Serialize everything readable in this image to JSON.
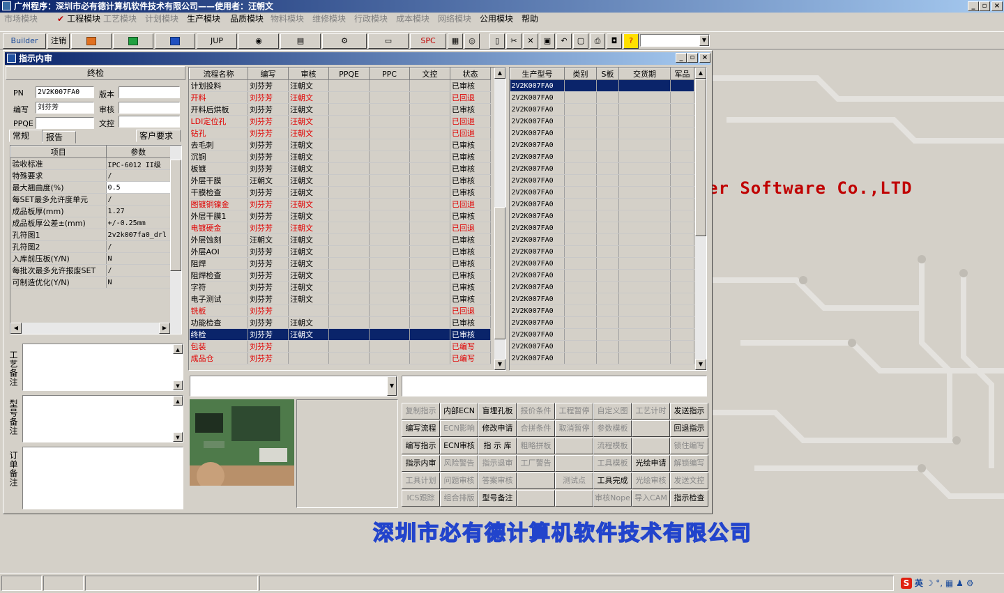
{
  "window_title": "广州程序：深圳市必有德计算机软件技术有限公司——使用者：汪朝文",
  "menu": [
    {
      "label": "市场模块",
      "enabled": false
    },
    {
      "label": "工程模块",
      "enabled": true,
      "checked": true
    },
    {
      "label": "工艺模块",
      "enabled": false
    },
    {
      "label": "计划模块",
      "enabled": false
    },
    {
      "label": "生产模块",
      "enabled": true
    },
    {
      "label": "品质模块",
      "enabled": true
    },
    {
      "label": "物料模块",
      "enabled": false
    },
    {
      "label": "维修模块",
      "enabled": false
    },
    {
      "label": "行政模块",
      "enabled": false
    },
    {
      "label": "成本模块",
      "enabled": false
    },
    {
      "label": "网络模块",
      "enabled": false
    },
    {
      "label": "公用模块",
      "enabled": true
    },
    {
      "label": "帮助",
      "enabled": true
    }
  ],
  "toolbar": {
    "builder": "Builder",
    "logout": "注销",
    "jup": "JUP",
    "spc": "SPC"
  },
  "child_title": "指示内审",
  "left": {
    "header": "终检",
    "pn_label": "PN",
    "pn_value": "2V2K007FA0",
    "version_label": "版本",
    "version_value": "",
    "author_label": "编写",
    "author_value": "刘芬芳",
    "review_label": "审核",
    "review_value": "",
    "ppqe_label": "PPQE",
    "ppqe_value": "",
    "doc_label": "文控",
    "doc_value": "",
    "tabs": [
      "常规",
      "报告",
      "客户要求"
    ],
    "param_headers": [
      "项目",
      "参数"
    ],
    "params": [
      [
        "验收标准",
        "IPC-6012 II级"
      ],
      [
        "特殊要求",
        "/"
      ],
      [
        "最大翘曲度(%)",
        "0.5"
      ],
      [
        "每SET最多允许度单元",
        "/"
      ],
      [
        "成品板厚(mm)",
        "1.27"
      ],
      [
        "成品板厚公差±(mm)",
        "+/-0.25mm"
      ],
      [
        "孔符图1",
        "2v2k007fa0_drl"
      ],
      [
        "孔符图2",
        "/"
      ],
      [
        "入库前压板(Y/N)",
        "N"
      ],
      [
        "每批次最多允许报废SET",
        "/"
      ],
      [
        "可制造优化(Y/N)",
        "N"
      ]
    ],
    "note_labels": [
      "工艺备注",
      "型号备注",
      "订单备注"
    ]
  },
  "flow": {
    "headers": [
      "流程名称",
      "编写",
      "审核",
      "PPQE",
      "PPC",
      "文控",
      "状态"
    ],
    "rows": [
      {
        "name": "计划投料",
        "author": "刘芬芳",
        "reviewer": "汪朝文",
        "status": "已审核",
        "red": false
      },
      {
        "name": "开料",
        "author": "刘芬芳",
        "reviewer": "汪朝文",
        "status": "已回退",
        "red": true
      },
      {
        "name": "开料后烘板",
        "author": "刘芬芳",
        "reviewer": "汪朝文",
        "status": "已审核",
        "red": false
      },
      {
        "name": "LDI定位孔",
        "author": "刘芬芳",
        "reviewer": "汪朝文",
        "status": "已回退",
        "red": true
      },
      {
        "name": "钻孔",
        "author": "刘芬芳",
        "reviewer": "汪朝文",
        "status": "已回退",
        "red": true
      },
      {
        "name": "去毛刺",
        "author": "刘芬芳",
        "reviewer": "汪朝文",
        "status": "已审核",
        "red": false
      },
      {
        "name": "沉铜",
        "author": "刘芬芳",
        "reviewer": "汪朝文",
        "status": "已审核",
        "red": false
      },
      {
        "name": "板镀",
        "author": "刘芬芳",
        "reviewer": "汪朝文",
        "status": "已审核",
        "red": false
      },
      {
        "name": "外层干膜",
        "author": "汪朝文",
        "reviewer": "汪朝文",
        "status": "已审核",
        "red": false
      },
      {
        "name": "干膜检查",
        "author": "刘芬芳",
        "reviewer": "汪朝文",
        "status": "已审核",
        "red": false
      },
      {
        "name": "图镀铜镍金",
        "author": "刘芬芳",
        "reviewer": "汪朝文",
        "status": "已回退",
        "red": true
      },
      {
        "name": "外层干膜1",
        "author": "刘芬芳",
        "reviewer": "汪朝文",
        "status": "已审核",
        "red": false
      },
      {
        "name": "电镀硬金",
        "author": "刘芬芳",
        "reviewer": "汪朝文",
        "status": "已回退",
        "red": true
      },
      {
        "name": "外层蚀刻",
        "author": "汪朝文",
        "reviewer": "汪朝文",
        "status": "已审核",
        "red": false
      },
      {
        "name": "外层AOI",
        "author": "刘芬芳",
        "reviewer": "汪朝文",
        "status": "已审核",
        "red": false
      },
      {
        "name": "阻焊",
        "author": "刘芬芳",
        "reviewer": "汪朝文",
        "status": "已审核",
        "red": false
      },
      {
        "name": "阻焊检查",
        "author": "刘芬芳",
        "reviewer": "汪朝文",
        "status": "已审核",
        "red": false
      },
      {
        "name": "字符",
        "author": "刘芬芳",
        "reviewer": "汪朝文",
        "status": "已审核",
        "red": false
      },
      {
        "name": "电子测试",
        "author": "刘芬芳",
        "reviewer": "汪朝文",
        "status": "已审核",
        "red": false
      },
      {
        "name": "铣板",
        "author": "刘芬芳",
        "reviewer": "",
        "status": "已回退",
        "red": true
      },
      {
        "name": "功能检查",
        "author": "刘芬芳",
        "reviewer": "汪朝文",
        "status": "已审核",
        "red": false
      },
      {
        "name": "终检",
        "author": "刘芬芳",
        "reviewer": "汪朝文",
        "status": "已审核",
        "red": false,
        "selected": true
      },
      {
        "name": "包装",
        "author": "刘芬芳",
        "reviewer": "",
        "status": "已编写",
        "red": true
      },
      {
        "name": "成品仓",
        "author": "刘芬芳",
        "reviewer": "",
        "status": "已编写",
        "red": true
      }
    ]
  },
  "models": {
    "headers": [
      "生产型号",
      "类别",
      "S板",
      "交货期",
      "军品"
    ],
    "value": "2V2K007FA0",
    "row_count": 24
  },
  "watermark": "er Software Co.,LTD",
  "company": "深圳市必有德计算机软件技术有限公司",
  "buttons": [
    [
      {
        "l": "复制指示",
        "d": true
      },
      {
        "l": "内部ECN",
        "d": false
      },
      {
        "l": "盲埋孔板",
        "d": false
      },
      {
        "l": "报价条件",
        "d": true
      },
      {
        "l": "工程暂停",
        "d": true
      },
      {
        "l": "自定义图",
        "d": true
      },
      {
        "l": "工艺计时",
        "d": true
      },
      {
        "l": "发送指示",
        "d": false
      }
    ],
    [
      {
        "l": "编写流程",
        "d": false
      },
      {
        "l": "ECN影响",
        "d": true
      },
      {
        "l": "修改申请",
        "d": false
      },
      {
        "l": "合拼条件",
        "d": true
      },
      {
        "l": "取消暂停",
        "d": true
      },
      {
        "l": "参数模板",
        "d": true
      },
      {
        "l": "",
        "d": true
      },
      {
        "l": "回退指示",
        "d": false
      }
    ],
    [
      {
        "l": "编写指示",
        "d": false
      },
      {
        "l": "ECN审核",
        "d": false
      },
      {
        "l": "指 示 库",
        "d": false
      },
      {
        "l": "粗略拼板",
        "d": true
      },
      {
        "l": "",
        "d": true
      },
      {
        "l": "流程模板",
        "d": true
      },
      {
        "l": "",
        "d": true
      },
      {
        "l": "锁住编写",
        "d": true
      }
    ],
    [
      {
        "l": "指示内审",
        "d": false
      },
      {
        "l": "风险警告",
        "d": true
      },
      {
        "l": "指示退审",
        "d": true
      },
      {
        "l": "工厂警告",
        "d": true
      },
      {
        "l": "",
        "d": true
      },
      {
        "l": "工具模板",
        "d": true
      },
      {
        "l": "光绘申请",
        "d": false
      },
      {
        "l": "解锁编写",
        "d": true
      }
    ],
    [
      {
        "l": "工具计划",
        "d": true
      },
      {
        "l": "问题审核",
        "d": true
      },
      {
        "l": "答案审核",
        "d": true
      },
      {
        "l": "",
        "d": true
      },
      {
        "l": "测试点",
        "d": true
      },
      {
        "l": "工具完成",
        "d": false
      },
      {
        "l": "光绘审核",
        "d": true
      },
      {
        "l": "发送文控",
        "d": true
      }
    ],
    [
      {
        "l": "ICS跟踪",
        "d": true
      },
      {
        "l": "组合排版",
        "d": true
      },
      {
        "l": "型号备注",
        "d": false
      },
      {
        "l": "",
        "d": true
      },
      {
        "l": "",
        "d": true
      },
      {
        "l": "审核Nope",
        "d": true
      },
      {
        "l": "导入CAM",
        "d": true
      },
      {
        "l": "指示检查",
        "d": false
      }
    ]
  ],
  "ime": {
    "lang": "英"
  }
}
